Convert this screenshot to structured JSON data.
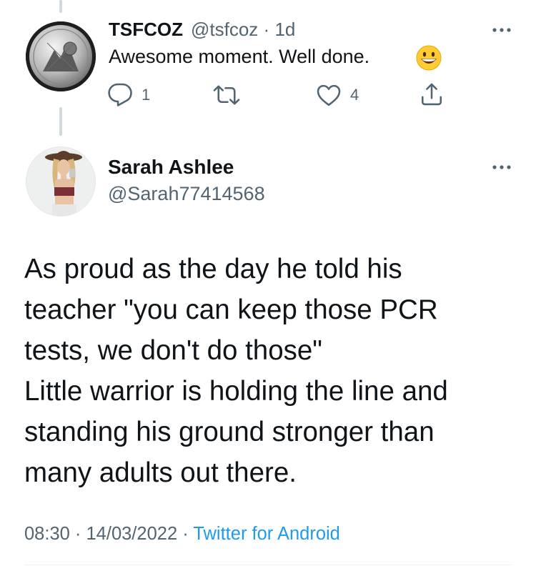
{
  "reply": {
    "name": "TSFCOZ",
    "handle": "@tsfcoz",
    "dot": "·",
    "time": "1d",
    "text": "Awesome moment.  Well done.",
    "emoji": "grinning-face-emoji",
    "replies": "1",
    "likes": "4"
  },
  "tweet": {
    "name": "Sarah Ashlee",
    "handle": "@Sarah77414568",
    "lines": [
      "As proud as the day he told his",
      "teacher \"you can keep those PCR",
      "tests, we don't do those\"",
      "Little warrior is holding the line and",
      "standing his ground stronger than",
      "many adults out there."
    ],
    "time": "08:30",
    "sep1": "·",
    "date": "14/03/2022",
    "sep2": "·",
    "source": "Twitter for Android"
  },
  "colors": {
    "text": "#0f1419",
    "secondary": "#536471",
    "link": "#1d9bf0",
    "thread_line": "#cfd9de"
  },
  "icons": [
    "more-icon",
    "reply-icon",
    "retweet-icon",
    "like-icon",
    "share-icon"
  ]
}
